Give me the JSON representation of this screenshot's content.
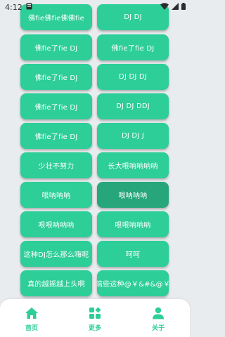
{
  "status_bar": {
    "time": "4:12",
    "icons": [
      "notification-icon",
      "wifi-icon",
      "signal-icon",
      "battery-icon"
    ]
  },
  "colors": {
    "accent": "#2dce98",
    "accent_pressed": "#27a67b",
    "background": "#e9ecee"
  },
  "buttons": [
    {
      "left": "佛fie佛fie佛佛fie",
      "right": "DJ DJ"
    },
    {
      "left": "佛fie了fie DJ",
      "right": "佛fie了fie DJ"
    },
    {
      "left": "佛fie了fie DJ",
      "right": "DJ DJ DJ"
    },
    {
      "left": "佛fie了fie DJ",
      "right": "DJ DJ DDJ"
    },
    {
      "left": "佛fie了fie DJ",
      "right": "DJ DJ J"
    },
    {
      "left": "少壮不努力",
      "right": "长大哏呐呐呐呐"
    },
    {
      "left": "哏呐呐呐",
      "right": "哏呐呐呐"
    },
    {
      "left": "哏哏呐呐呐",
      "right": "哏哏呐呐呐"
    },
    {
      "left": "这种DJ怎么那么嗨呢",
      "right": "呵呵"
    },
    {
      "left": "真的越摇越上头啊",
      "right": "搞些这种@￥&#&@￥"
    }
  ],
  "pressed_button": {
    "row": 6,
    "side": "right"
  },
  "bottom_nav": {
    "items": [
      {
        "label": "首页",
        "icon": "home-icon"
      },
      {
        "label": "更多",
        "icon": "more-icon"
      },
      {
        "label": "关于",
        "icon": "person-icon"
      }
    ]
  }
}
